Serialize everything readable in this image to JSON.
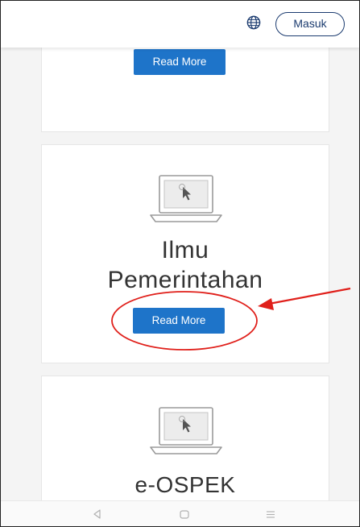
{
  "header": {
    "language_icon": "globe-icon",
    "login_label": "Masuk"
  },
  "cards": [
    {
      "title": "",
      "button_label": "Read More"
    },
    {
      "title": "Ilmu\nPemerintahan",
      "icon": "laptop-icon",
      "button_label": "Read More"
    },
    {
      "title": "e-OSPEK",
      "icon": "laptop-icon"
    }
  ],
  "annotation": {
    "highlight_color": "#e0201b",
    "shapes": [
      "ellipse-highlight",
      "arrow-pointer"
    ]
  },
  "navigation": {
    "icons": [
      "back-icon",
      "home-icon",
      "recent-apps-icon"
    ]
  },
  "colors": {
    "button_blue": "#1e74c9",
    "login_outline": "#1b3b6f",
    "annotation_red": "#e0201b"
  }
}
